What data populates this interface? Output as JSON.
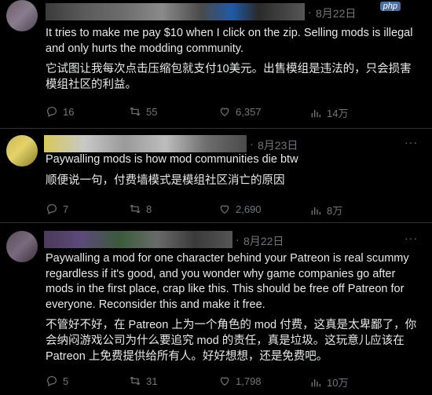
{
  "watermark": "php",
  "tweets": [
    {
      "date": "8月22日",
      "text": "It tries to make me pay $10 when I click on the zip. Selling mods is illegal and only hurts the modding community.",
      "translation": "它试图让我每次点击压缩包就支付10美元。出售模组是违法的，只会损害模组社区的利益。",
      "replies": "16",
      "reposts": "55",
      "likes": "6,357",
      "views": "14万"
    },
    {
      "date": "8月23日",
      "text": "Paywalling mods is how mod communities die btw",
      "translation": "顺便说一句，付费墙模式是模组社区消亡的原因",
      "replies": "7",
      "reposts": "8",
      "likes": "2,690",
      "views": "8万"
    },
    {
      "date": "8月22日",
      "text": "Paywalling a mod for one character behind your Patreon is real scummy regardless if it's good, and you wonder why game companies go after mods in the first place, crap like this. This should be free off Patreon for everyone. Reconsider this and make it free.",
      "translation": "不管好不好，在 Patreon 上为一个角色的 mod 付费，这真是太卑鄙了，你会纳闷游戏公司为什么要追究 mod 的责任，真是垃圾。这玩意儿应该在 Patreon 上免费提供给所有人。好好想想，还是免费吧。",
      "replies": "5",
      "reposts": "31",
      "likes": "1,798",
      "views": "10万"
    }
  ],
  "icons": {
    "reply": "reply-icon",
    "repost": "repost-icon",
    "like": "like-icon",
    "views": "views-icon",
    "more": "more-icon"
  }
}
